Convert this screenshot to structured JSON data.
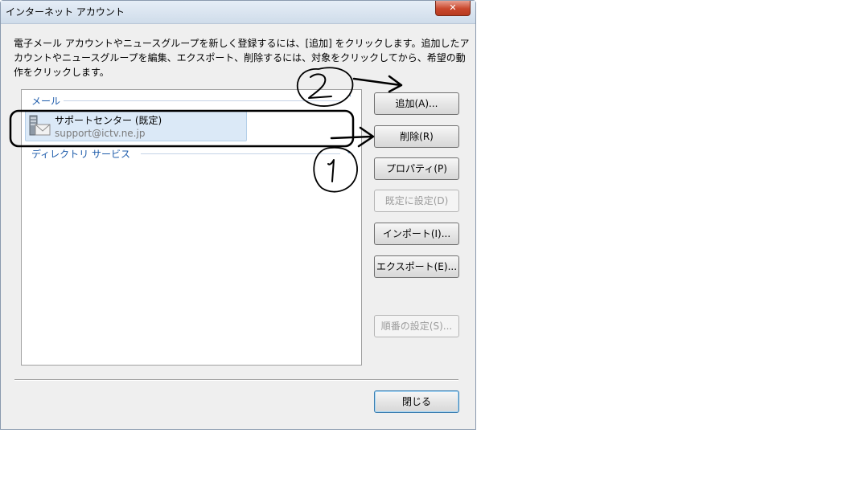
{
  "window": {
    "title": "インターネット アカウント",
    "close_glyph": "✕"
  },
  "description": "電子メール アカウントやニュースグループを新しく登録するには、[追加] をクリックします。追加したアカウントやニュースグループを編集、エクスポート、削除するには、対象をクリックしてから、希望の動作をクリックします。",
  "account_list": {
    "groups": [
      {
        "label": "メール",
        "accounts": [
          {
            "name": "サポートセンター (既定)",
            "email": "support@ictv.ne.jp",
            "icon": "mail-account-icon"
          }
        ]
      },
      {
        "label": "ディレクトリ サービス"
      }
    ]
  },
  "buttons": {
    "add": "追加(A)...",
    "remove": "削除(R)",
    "properties": "プロパティ(P)",
    "set_default": "既定に設定(D)",
    "import": "インポート(I)...",
    "export": "エクスポート(E)...",
    "set_order": "順番の設定(S)...",
    "close": "閉じる"
  },
  "colors": {
    "group_label": "#1e5cab",
    "selection": "#dbe9f7",
    "annotation_ink": "#000000"
  }
}
